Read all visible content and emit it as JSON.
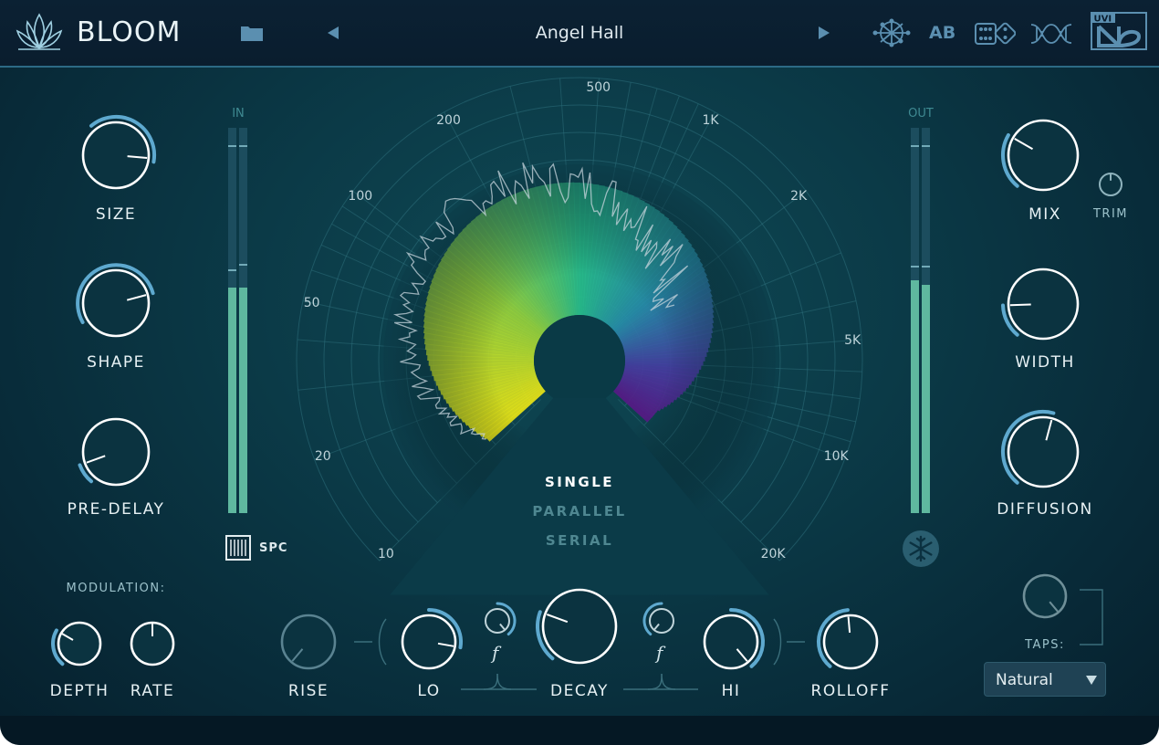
{
  "header": {
    "app_name": "BLOOM",
    "preset_name": "Angel Hall",
    "ab_label": "AB",
    "brand": "UVI"
  },
  "meters": {
    "in_label": "IN",
    "out_label": "OUT",
    "spc_label": "SPC"
  },
  "knobs": {
    "size": "SIZE",
    "shape": "SHAPE",
    "pre_delay": "PRE-DELAY",
    "mix": "MIX",
    "trim": "TRIM",
    "width": "WIDTH",
    "diffusion": "DIFFUSION",
    "depth": "DEPTH",
    "rate": "RATE",
    "rise": "RISE",
    "lo": "LO",
    "decay": "DECAY",
    "hi": "HI",
    "rolloff": "ROLLOFF",
    "filter_glyph": "f"
  },
  "modulation_label": "MODULATION:",
  "taps": {
    "label": "TAPS:",
    "selected": "Natural"
  },
  "modes": {
    "single": "SINGLE",
    "parallel": "PARALLEL",
    "serial": "SERIAL"
  },
  "freq_labels": [
    "10",
    "20",
    "50",
    "100",
    "200",
    "500",
    "1K",
    "2K",
    "5K",
    "10K",
    "20K"
  ],
  "colors": {
    "accent": "#5ea9cf",
    "meter": "#5fb89f",
    "background": "#0b3a47"
  }
}
